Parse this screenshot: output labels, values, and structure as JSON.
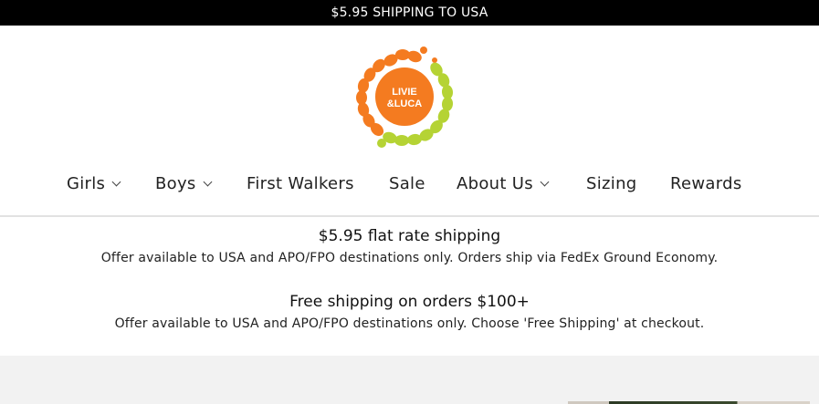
{
  "announcement": {
    "text": "$5.95 SHIPPING TO USA"
  },
  "logo": {
    "line1": "LIVIE",
    "line2": "&LUCA",
    "alt": "Livie & Luca logo"
  },
  "nav": {
    "items": [
      {
        "label": "Girls",
        "has_dropdown": true
      },
      {
        "label": "Boys",
        "has_dropdown": true
      },
      {
        "label": "First Walkers",
        "has_dropdown": false
      },
      {
        "label": "Sale",
        "has_dropdown": false
      },
      {
        "label": "About Us",
        "has_dropdown": true
      },
      {
        "label": "Sizing",
        "has_dropdown": false
      },
      {
        "label": "Rewards",
        "has_dropdown": false
      }
    ]
  },
  "promos": [
    {
      "title": "$5.95 flat rate shipping",
      "text": "Offer available to USA and APO/FPO destinations only. Orders ship via FedEx Ground Economy."
    },
    {
      "title": "Free shipping on orders $100+",
      "text": "Offer available to USA and APO/FPO destinations only. Choose 'Free Shipping' at checkout."
    }
  ],
  "colors": {
    "announcement_bg": "#000000",
    "logo_orange": "#f47b20",
    "logo_green": "#b5d334",
    "grey_band": "#f2f2f2"
  }
}
